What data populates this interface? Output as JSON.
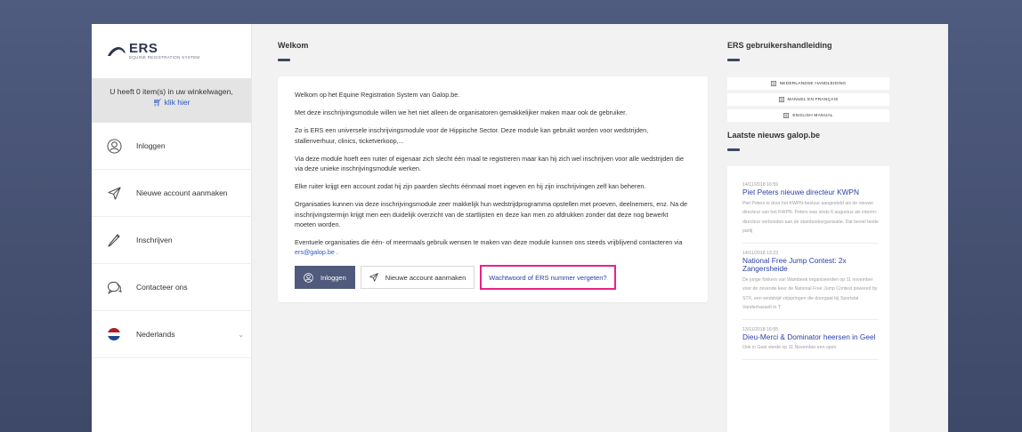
{
  "logo": {
    "name": "ERS",
    "subtitle": "EQUINE REGISTRATION SYSTEM"
  },
  "cart": {
    "text": "U heeft 0 item(s) in uw winkelwagen,",
    "link": "klik hier"
  },
  "sidebar": {
    "items": [
      {
        "label": "Inloggen",
        "icon": "user-icon"
      },
      {
        "label": "Nieuwe account aanmaken",
        "icon": "paper-plane-icon"
      },
      {
        "label": "Inschrijven",
        "icon": "pencil-icon"
      },
      {
        "label": "Contacteer ons",
        "icon": "chat-icon"
      },
      {
        "label": "Nederlands",
        "icon": "flag-nl-icon"
      }
    ]
  },
  "main": {
    "title": "Welkom",
    "paragraphs": [
      "Welkom op het Equine Registration System van Galop.be.",
      "Met deze inschrijvingsmodule willen we het niet alleen de organisatoren gemakkelijker maken maar ook de gebruiker.",
      "Zo is ERS een universele inschrijvingsmodule voor de Hippische Sector. Deze module kan gebruikt worden voor wedstrijden, stallenverhuur, clinics, ticketverkoop,...",
      "Via deze module hoeft een ruiter of eigenaar zich slecht één maal te registreren maar kan hij zich wel inschrijven voor alle wedstrijden die via deze unieke inschrijvingsmodule werken.",
      "Elke ruiter krijgt een account zodat hij zijn paarden slechts éénmaal moet ingeven en hij zijn inschrijvingen zelf kan beheren.",
      "Organisaties kunnen via deze inschrijvingsmodule zeer makkelijk hun wedstrijdprogramma opstellen met proeven, deelnemers, enz. Na de inschrijvingstermijn krijgt men een duidelijk overzicht van de startlijsten en deze kan men zo afdrukken zonder dat deze nog bewerkt moeten worden."
    ],
    "last_paragraph": "Eventuele organisaties die één- of meermaals gebruik wensen te maken van deze module kunnen ons steeds vrijblijvend contacteren via",
    "email": "ers@galop.be",
    "last_suffix": " .",
    "buttons": {
      "login": "Inloggen",
      "new_account": "Nieuwe account aanmaken",
      "forgot": "Wachtwoord of ERS nummer vergeten?"
    }
  },
  "right": {
    "manual_title": "ERS gebruikershandleiding",
    "manuals": [
      "NEDERLANDSE HANDLEIDING",
      "MANUEL EN FRANÇAIS",
      "ENGLISH MANUAL"
    ],
    "news_title": "Laatste nieuws galop.be",
    "news": [
      {
        "date": "14/11/2018 16:59",
        "title": "Piet Peters nieuwe directeur KWPN",
        "body": "Piet Peters is door het KWPN-bestuur aangesteld als de nieuwe directeur van het KWPN. Peters was sinds 6 augustus als interim-directeur verbonden aan de stamboekorganisatie. Dat beviel beide partij"
      },
      {
        "date": "14/11/2018 13:23",
        "title": "National Free Jump Contest: 2x Zangersheide",
        "body": "De jonge fokkers van Wambeek organiseerden op 11 november voor de zevende keer de National Free Jump Contest powered by STX, een wedstrijd vrijspringen die doorgaat bij Sportstal Vanderhasselt in T"
      },
      {
        "date": "13/11/2018 16:55",
        "title": "Dieu-Merci & Dominator heersen in Geel",
        "body": "Ook in Geel vierde op 11 November een open"
      }
    ]
  }
}
